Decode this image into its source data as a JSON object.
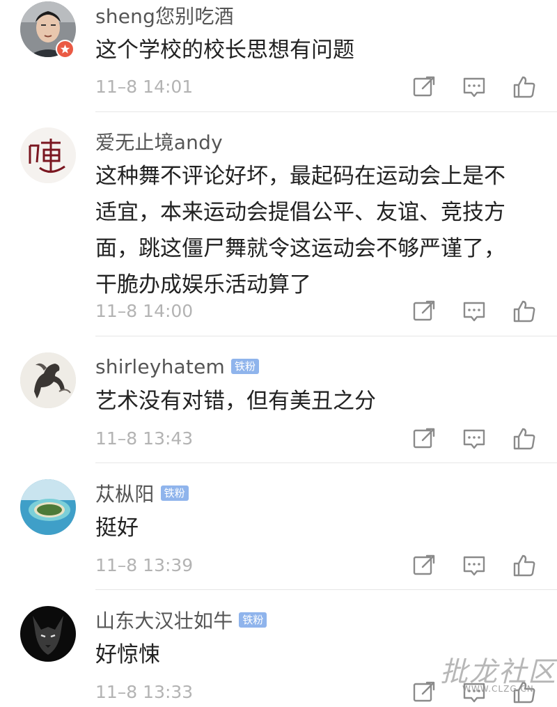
{
  "comments": [
    {
      "username": "sheng您别吃酒",
      "badge": "",
      "text": "这个学校的校长思想有问题",
      "time": "11–8 14:01",
      "avatar_icon": "man-portrait-avatar",
      "vip": true
    },
    {
      "username": "爱无止境andy",
      "badge": "",
      "text": "这种舞不评论好坏，最起码在运动会上是不\n适宜，本来运动会提倡公平、友谊、竞技方\n面，跳这僵尸舞就令这运动会不够严谨了，\n干脆办成娱乐活动算了",
      "time": "11–8 14:00",
      "avatar_icon": "calligraphy-logo-avatar",
      "vip": false
    },
    {
      "username": "shirleyhatem",
      "badge": "铁粉",
      "text": "艺术没有对错，但有美丑之分",
      "time": "11–8 13:43",
      "avatar_icon": "horse-painting-avatar",
      "vip": false
    },
    {
      "username": "苁枞阳",
      "badge": "铁粉",
      "text": "挺好",
      "time": "11–8 13:39",
      "avatar_icon": "island-avatar",
      "vip": false
    },
    {
      "username": "山东大汉壮如牛",
      "badge": "铁粉",
      "text": "好惊悚",
      "time": "11–8 13:33",
      "avatar_icon": "wolf-avatar",
      "vip": false
    }
  ],
  "watermark": {
    "title": "批龙社区",
    "url": "WWW.CLZG.CN"
  },
  "colors": {
    "username": "#555555",
    "text": "#222222",
    "timestamp": "#b3b3b3",
    "fan_badge": "#8fb4ec",
    "icon": "#8a8a8a"
  }
}
